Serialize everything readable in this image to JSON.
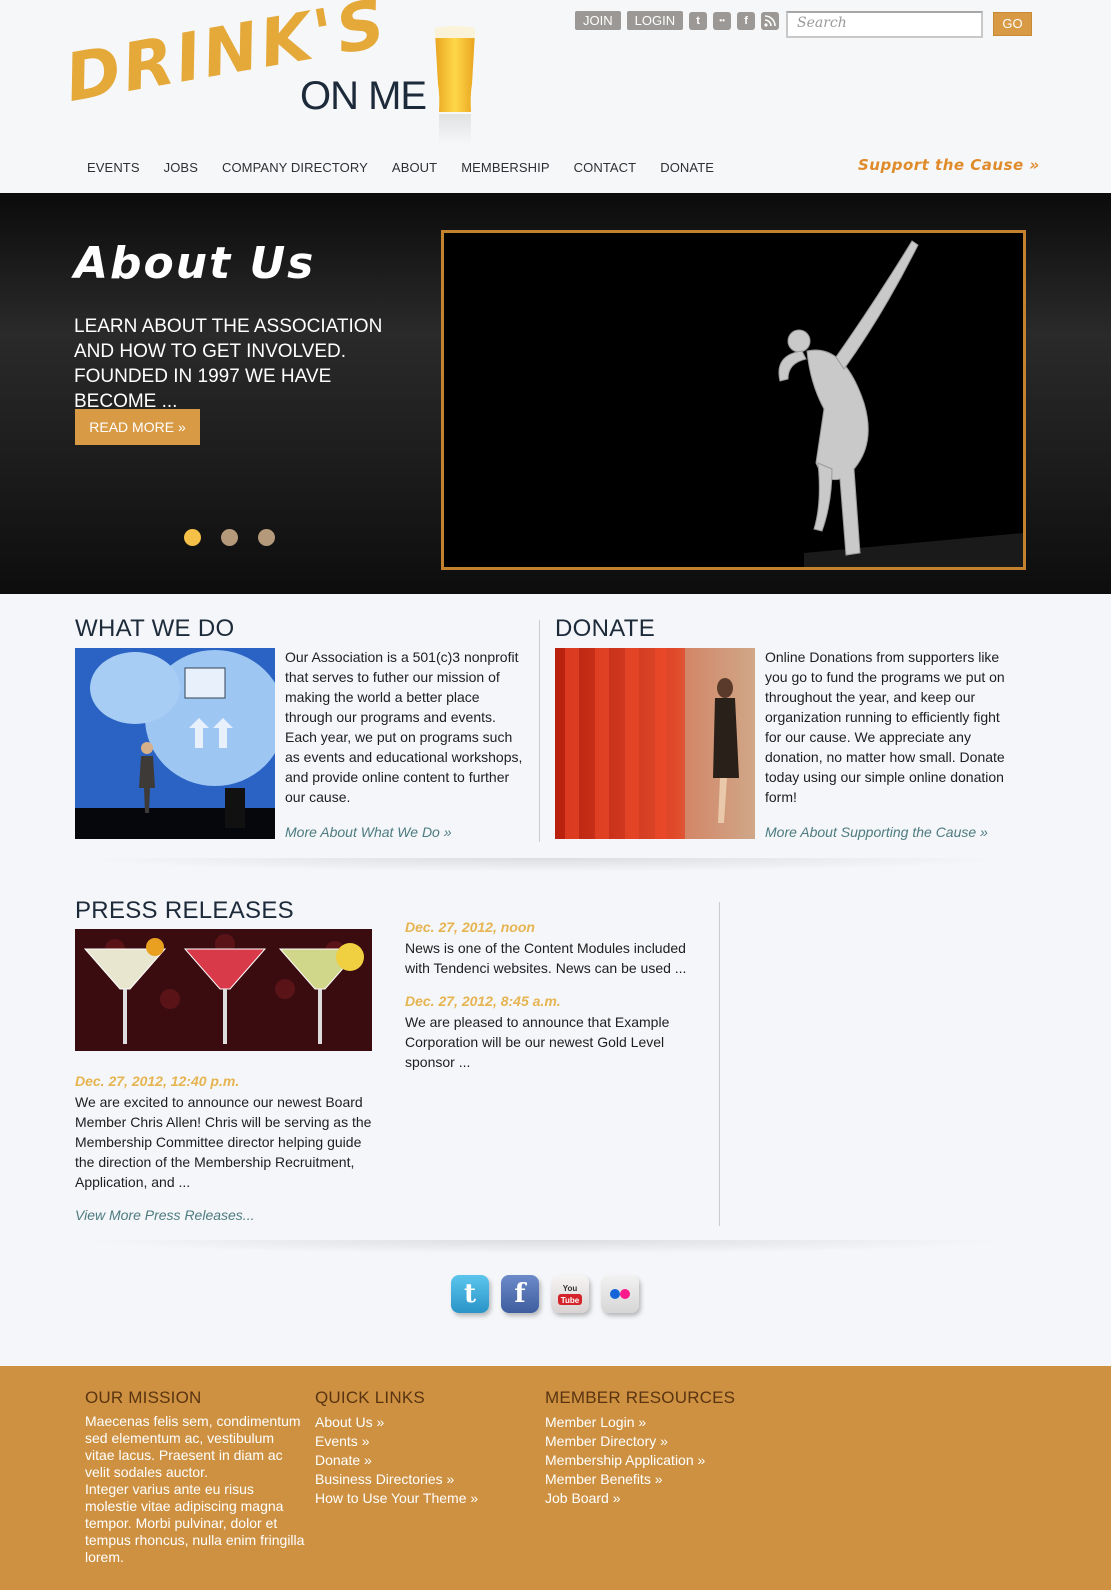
{
  "topbar": {
    "join": "JOIN",
    "login": "LOGIN",
    "social": [
      "t",
      "••",
      "f",
      "rss"
    ],
    "search_placeholder": "Search",
    "go": "GO"
  },
  "logo": {
    "word1": "DRINK'S",
    "word2": "ON ME"
  },
  "nav": [
    "EVENTS",
    "JOBS",
    "COMPANY DIRECTORY",
    "ABOUT",
    "MEMBERSHIP",
    "CONTACT",
    "DONATE"
  ],
  "support_link": "Support the Cause »",
  "hero": {
    "title": "About Us",
    "text": "LEARN ABOUT THE ASSOCIATION AND HOW TO GET INVOLVED. FOUNDED IN 1997 WE HAVE BECOME ...",
    "button": "READ MORE »",
    "slides": 3,
    "active_slide": 1
  },
  "what_we_do": {
    "title": "WHAT WE DO",
    "text": "Our Association is a 501(c)3 nonprofit that serves to futher our mission of making the world a better place through our programs and events. Each year, we put on programs such as events and educational workshops, and provide online content to further our cause.",
    "more": "More About What We Do »"
  },
  "donate": {
    "title": "DONATE",
    "text": "Online Donations from supporters like you go to fund the programs we put on throughout the year, and keep our organization running to efficiently fight for our cause. We appreciate any donation, no matter how small. Donate today using our simple online donation form!",
    "more": "More About Supporting the Cause »"
  },
  "press": {
    "title": "PRESS RELEASES",
    "items": [
      {
        "date": "Dec. 27, 2012, 12:40 p.m.",
        "text": "We are excited to announce our newest Board Member Chris Allen! Chris will be serving as the Membership Committee director helping guide the direction of the Membership Recruitment, Application, and ..."
      },
      {
        "date": "Dec. 27, 2012, noon",
        "text": "News is one of the Content Modules included with Tendenci websites. News can be used ..."
      },
      {
        "date": "Dec. 27, 2012, 8:45 a.m.",
        "text": "We are pleased to announce that Example Corporation will be our newest Gold Level sponsor ..."
      }
    ],
    "more": "View More Press Releases..."
  },
  "social_bottom": [
    {
      "name": "twitter",
      "glyph": "t",
      "color": "#38a8d8"
    },
    {
      "name": "facebook",
      "glyph": "f",
      "color": "#4a6aa8"
    },
    {
      "name": "youtube",
      "glyph": "You Tube",
      "color": "#e9e5e5"
    },
    {
      "name": "flickr",
      "glyph": "••",
      "color": "#e4e4e4"
    }
  ],
  "footer": {
    "mission_title": "OUR MISSION",
    "mission_text": "Maecenas felis sem, condimentum sed elementum ac, vestibulum vitae lacus. Praesent in diam ac velit sodales auctor.",
    "mission_text2": "Integer varius ante eu risus molestie vitae adipiscing magna tempor. Morbi pulvinar, dolor et tempus rhoncus, nulla enim fringilla lorem.",
    "quick_title": "QUICK LINKS",
    "quick_links": [
      "About Us »",
      "Events »",
      "Donate »",
      "Business Directories »",
      "How to Use Your Theme »"
    ],
    "member_title": "MEMBER RESOURCES",
    "member_links": [
      "Member Login »",
      "Member Directory »",
      "Membership Application »",
      "Member Benefits »",
      "Job Board »"
    ]
  }
}
